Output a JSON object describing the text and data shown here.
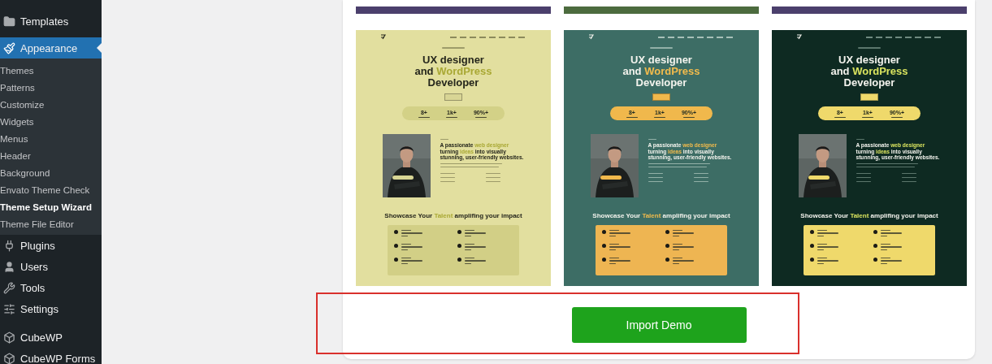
{
  "sidebar": {
    "items": [
      {
        "label": "Templates",
        "selected": false
      },
      {
        "label": "Appearance",
        "selected": true,
        "children": [
          {
            "label": "Themes",
            "selected": false
          },
          {
            "label": "Patterns",
            "selected": false
          },
          {
            "label": "Customize",
            "selected": false
          },
          {
            "label": "Widgets",
            "selected": false
          },
          {
            "label": "Menus",
            "selected": false
          },
          {
            "label": "Header",
            "selected": false
          },
          {
            "label": "Background",
            "selected": false
          },
          {
            "label": "Envato Theme Check",
            "selected": false
          },
          {
            "label": "Theme Setup Wizard",
            "selected": true
          },
          {
            "label": "Theme File Editor",
            "selected": false
          }
        ]
      },
      {
        "label": "Plugins",
        "selected": false
      },
      {
        "label": "Users",
        "selected": false
      },
      {
        "label": "Tools",
        "selected": false
      },
      {
        "label": "Settings",
        "selected": false
      },
      {
        "label": "CubeWP",
        "selected": false
      },
      {
        "label": "CubeWP Forms",
        "selected": false
      }
    ]
  },
  "cut_previews": [
    {
      "color": "#4b3f6c"
    },
    {
      "color": "#4c6b3e"
    },
    {
      "color": "#4b3f6c"
    }
  ],
  "previews": [
    {
      "kind": "light",
      "hero_lines": [
        [
          {
            "text": "UX designer"
          }
        ],
        [
          {
            "text": "and "
          },
          {
            "text": "WordPress",
            "accent": true
          }
        ],
        [
          {
            "text": "Developer"
          }
        ]
      ],
      "stats": [
        "8+",
        "1k+",
        "90%+"
      ],
      "about_lines": [
        [
          {
            "text": "A passionate "
          },
          {
            "text": "web designer",
            "accent": true
          }
        ],
        [
          {
            "text": "turning "
          },
          {
            "text": "ideas",
            "accent": true
          },
          {
            "text": " into visually"
          }
        ],
        [
          {
            "text": "stunning, user-friendly websites."
          }
        ]
      ],
      "showcase": [
        {
          "text": "Showcase Your "
        },
        {
          "text": "Talent",
          "accent": true
        },
        {
          "text": " amplifing your impact"
        }
      ]
    },
    {
      "kind": "teal",
      "hero_lines": [
        [
          {
            "text": "UX designer"
          }
        ],
        [
          {
            "text": "and "
          },
          {
            "text": "WordPress",
            "accent": true
          }
        ],
        [
          {
            "text": "Developer"
          }
        ]
      ],
      "stats": [
        "8+",
        "1k+",
        "90%+"
      ],
      "about_lines": [
        [
          {
            "text": "A passionate "
          },
          {
            "text": "web designer",
            "accent": true
          }
        ],
        [
          {
            "text": "turning "
          },
          {
            "text": "ideas",
            "accent": true
          },
          {
            "text": " into visually"
          }
        ],
        [
          {
            "text": "stunning, user-friendly websites."
          }
        ]
      ],
      "showcase": [
        {
          "text": "Showcase Your "
        },
        {
          "text": "Talent",
          "accent": true
        },
        {
          "text": " amplifing your impact"
        }
      ]
    },
    {
      "kind": "dark",
      "hero_lines": [
        [
          {
            "text": "UX designer"
          }
        ],
        [
          {
            "text": "and "
          },
          {
            "text": "WordPress",
            "accent": true
          }
        ],
        [
          {
            "text": "Developer"
          }
        ]
      ],
      "stats": [
        "8+",
        "1k+",
        "90%+"
      ],
      "about_lines": [
        [
          {
            "text": "A passionate "
          },
          {
            "text": "web designer",
            "accent": true
          }
        ],
        [
          {
            "text": "turning "
          },
          {
            "text": "ideas",
            "accent": true
          },
          {
            "text": " into visually"
          }
        ],
        [
          {
            "text": "stunning, user-friendly websites."
          }
        ]
      ],
      "showcase": [
        {
          "text": "Showcase Your "
        },
        {
          "text": "Talent",
          "accent": true
        },
        {
          "text": " amplifing your impact"
        }
      ]
    }
  ],
  "import_button": {
    "label": "Import Demo"
  }
}
